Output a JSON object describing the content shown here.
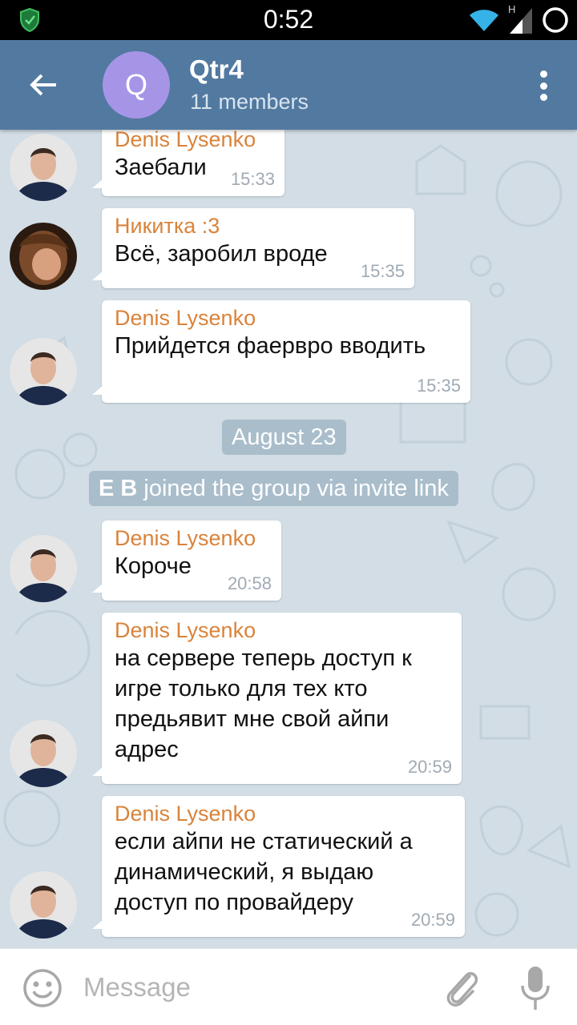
{
  "status_bar": {
    "time": "0:52",
    "network_label": "H",
    "icons": [
      "shield-icon",
      "wifi-icon",
      "signal-icon",
      "circle-icon"
    ]
  },
  "header": {
    "avatar_letter": "Q",
    "title": "Qtr4",
    "subtitle": "11 members",
    "colors": {
      "bar": "#5279a0",
      "avatar": "#a695e7"
    }
  },
  "messages": [
    {
      "sender": "Denis Lysenko",
      "lines": [
        "Заебали"
      ],
      "time": "15:33",
      "avatar": "denis"
    },
    {
      "sender": "Никитка :3",
      "lines": [
        "Всё, заробил вроде"
      ],
      "time": "15:35",
      "avatar": "nikita"
    },
    {
      "sender": "Denis Lysenko",
      "lines": [
        "Прийдется фаервро вводить"
      ],
      "time": "15:35",
      "avatar": "denis"
    },
    {
      "sender": "Denis Lysenko",
      "lines": [
        "Короче"
      ],
      "time": "20:58",
      "avatar": "denis"
    },
    {
      "sender": "Denis Lysenko",
      "lines": [
        "на сервере теперь доступ к",
        "игре только для тех кто",
        "предьявит мне свой айпи",
        "адрес"
      ],
      "time": "20:59",
      "avatar": "denis"
    },
    {
      "sender": "Denis Lysenko",
      "lines": [
        "если айпи не статический а",
        "динамический, я выдаю",
        "доступ по провайдеру"
      ],
      "time": "20:59",
      "avatar": "denis"
    }
  ],
  "date_separator": "August 23",
  "service_message": {
    "name": "E B",
    "text": " joined the group via invite link"
  },
  "input": {
    "placeholder": "Message"
  },
  "colors": {
    "sender_name": "#d9833b",
    "time": "#a0aab4"
  }
}
